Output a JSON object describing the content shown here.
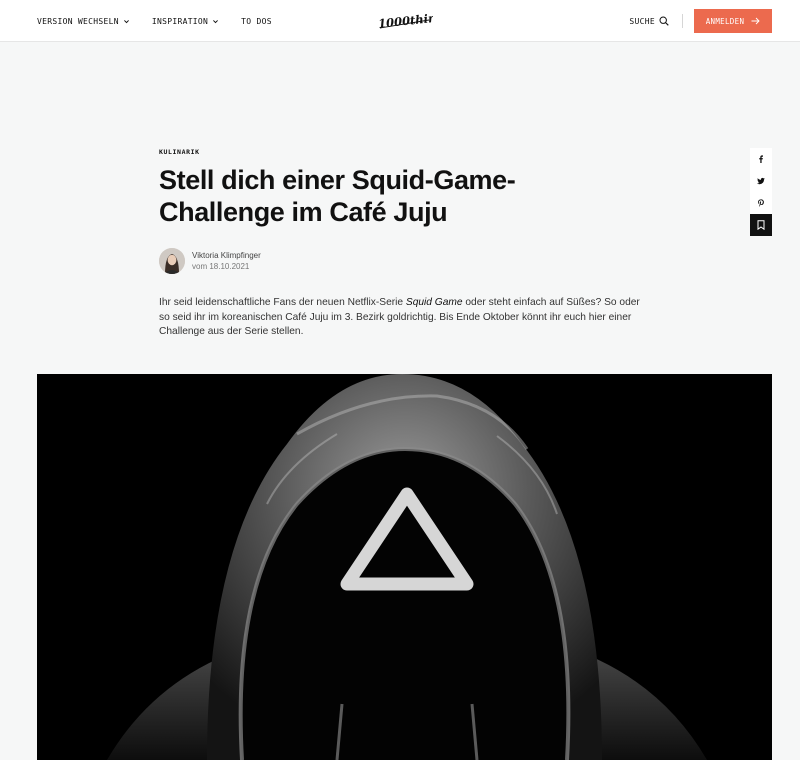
{
  "header": {
    "nav": [
      {
        "label": "VERSION WECHSELN",
        "has_dropdown": true
      },
      {
        "label": "INSPIRATION",
        "has_dropdown": true
      },
      {
        "label": "TO DOS",
        "has_dropdown": false
      }
    ],
    "logo_text": "1000things",
    "search_label": "SUCHE",
    "login_label": "ANMELDEN",
    "accent_color": "#ec6a4e"
  },
  "article": {
    "category": "KULINARIK",
    "title": "Stell dich einer Squid-Game-Challenge im Café Juju",
    "author_name": "Viktoria Klimpfinger",
    "author_date": "vom 18.10.2021",
    "lead_before": "Ihr seid leidenschaftliche Fans der neuen Netflix-Serie ",
    "lead_emphasis": "Squid Game",
    "lead_after": " oder steht einfach auf Süßes? So oder so seid ihr im koreanischen Café Juju im 3. Bezirk goldrichtig. Bis Ende Oktober könnt ihr euch hier einer Challenge aus der Serie stellen."
  },
  "share": {
    "icons": [
      "facebook-icon",
      "twitter-icon",
      "pinterest-icon",
      "bookmark-icon"
    ]
  }
}
